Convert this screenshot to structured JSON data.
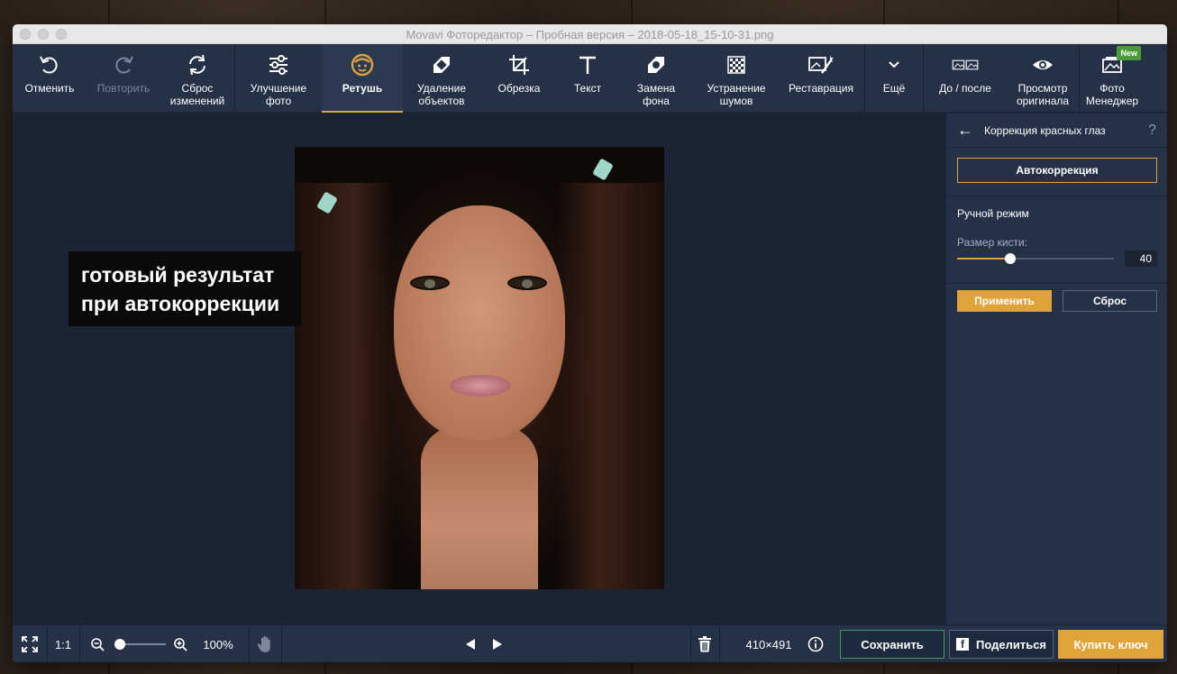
{
  "window": {
    "title": "Movavi Фоторедактор – Пробная версия – 2018-05-18_15-10-31.png"
  },
  "toolbar": {
    "undo": "Отменить",
    "redo": "Повторить",
    "reset": "Сброс\nизменений",
    "enhance": "Улучшение\nфото",
    "retouch": "Ретушь",
    "remove_objects": "Удаление\nобъектов",
    "crop": "Обрезка",
    "text": "Текст",
    "replace_bg": "Замена\nфона",
    "denoise": "Устранение\nшумов",
    "restore": "Реставрация",
    "more": "Ещё",
    "before_after": "До / после",
    "view_original": "Просмотр\nоригинала",
    "photo_manager": "Фото\nМенеджер",
    "new_badge": "New",
    "active_tool": "retouch",
    "disabled_tools": [
      "redo"
    ]
  },
  "annotation": {
    "line1": "готовый результат",
    "line2": "при автокоррекции"
  },
  "panel": {
    "title": "Коррекция красных глаз",
    "help": "?",
    "auto_button": "Автокоррекция",
    "manual_heading": "Ручной режим",
    "brush_label": "Размер кисти:",
    "brush_value": "40",
    "brush_fraction": 0.34,
    "apply_button": "Применить",
    "reset_button": "Сброс"
  },
  "statusbar": {
    "fit_icon": "fit-screen-icon",
    "one_to_one": "1:1",
    "zoom_value": "100%",
    "zoom_fraction": 0.0,
    "dimensions": "410×491",
    "save": "Сохранить",
    "share": "Поделиться",
    "buy": "Купить ключ"
  },
  "colors": {
    "accent": "#e0a33a",
    "toolbar": "#243147",
    "canvas": "#1b2433",
    "save_border": "#3f9a5a"
  }
}
